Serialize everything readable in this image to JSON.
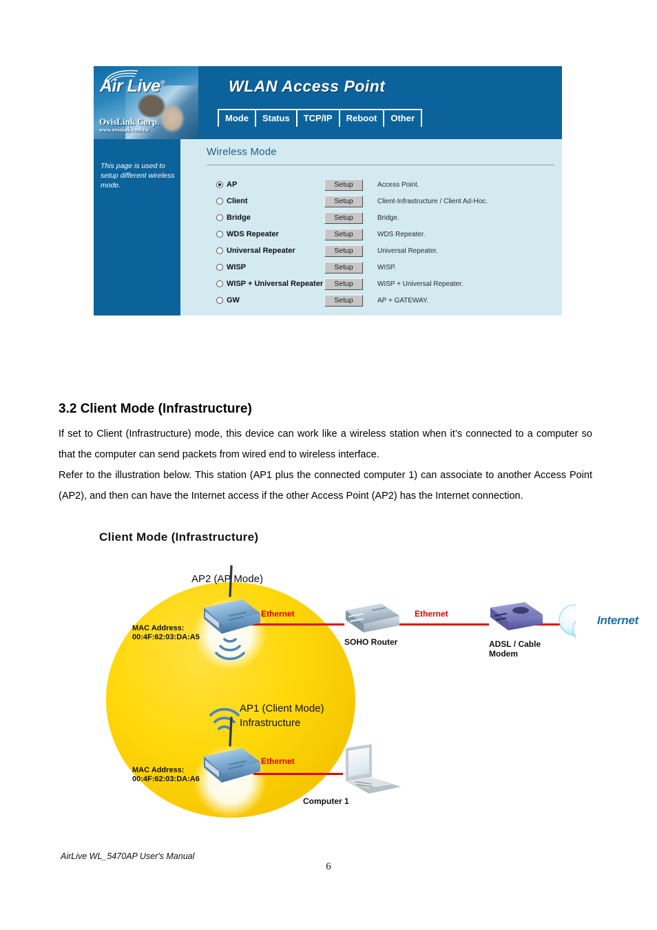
{
  "router_ui": {
    "brand": {
      "logo_text": "Air Live",
      "logo_registered": "®",
      "company": "OvisLink Corp.",
      "website": "www.ovislink.com.tw"
    },
    "title": "WLAN Access Point",
    "tabs": [
      {
        "label": "Mode"
      },
      {
        "label": "Status"
      },
      {
        "label": "TCP/IP"
      },
      {
        "label": "Reboot"
      },
      {
        "label": "Other"
      }
    ],
    "sidebar_note": "This page is used to setup different wireless mode.",
    "panel_title": "Wireless Mode",
    "setup_label": "Setup",
    "modes": [
      {
        "label": "AP",
        "selected": true,
        "description": "Access Point."
      },
      {
        "label": "Client",
        "selected": false,
        "description": "Client-Infrastructure / Client Ad-Hoc."
      },
      {
        "label": "Bridge",
        "selected": false,
        "description": "Bridge."
      },
      {
        "label": "WDS Repeater",
        "selected": false,
        "description": "WDS Repeater."
      },
      {
        "label": "Universal Repeater",
        "selected": false,
        "description": "Universal Repeater."
      },
      {
        "label": "WISP",
        "selected": false,
        "description": "WISP."
      },
      {
        "label": "WISP + Universal Repeater",
        "selected": false,
        "description": "WISP + Universal Repeater."
      },
      {
        "label": "GW",
        "selected": false,
        "description": "AP + GATEWAY."
      }
    ],
    "colors": {
      "header_blue": "#0c639c",
      "panel_bg": "#d3eaf0",
      "panel_title": "#1a5e93"
    }
  },
  "document": {
    "section_heading": "3.2 Client Mode (Infrastructure)",
    "paragraph_1": "If set to Client (Infrastructure) mode, this device can work like a wireless station when it’s connected to a computer so that the computer can send packets from wired end to wireless interface.",
    "paragraph_2": "Refer to the illustration below. This station (AP1 plus the connected computer 1) can associate to another Access Point (AP2), and then can have the Internet access if the other Access Point (AP2) has the Internet connection."
  },
  "diagram": {
    "title": "Client Mode (Infrastructure)",
    "ap2_label": "AP2 (AP Mode)",
    "ap2_mac_line1": "MAC Address:",
    "ap2_mac_line2": "00:4F:62:03:DA:A5",
    "ap1_label_line1": "AP1 (Client Mode)",
    "ap1_label_line2": "Infrastructure",
    "ap1_mac_line1": "MAC Address:",
    "ap1_mac_line2": "00:4F:62:03:DA:A6",
    "soho_router_label": "SOHO Router",
    "modem_label_line1": "ADSL / Cable",
    "modem_label_line2": "Modem",
    "internet_label": "Internet",
    "computer_label": "Computer 1",
    "ethernet_label_1": "Ethernet",
    "ethernet_label_2": "Ethernet",
    "ethernet_label_3": "Ethernet",
    "colors": {
      "coverage_yellow": "#ffd80a",
      "ethernet_red": "#e40000",
      "cloud_blue": "#8fd3f0",
      "device_blue": "#7fa9cf",
      "modem_purple": "#7f7fc0"
    }
  },
  "footer": {
    "manual_title": "AirLive WL_5470AP User's Manual",
    "page_number": "6"
  }
}
